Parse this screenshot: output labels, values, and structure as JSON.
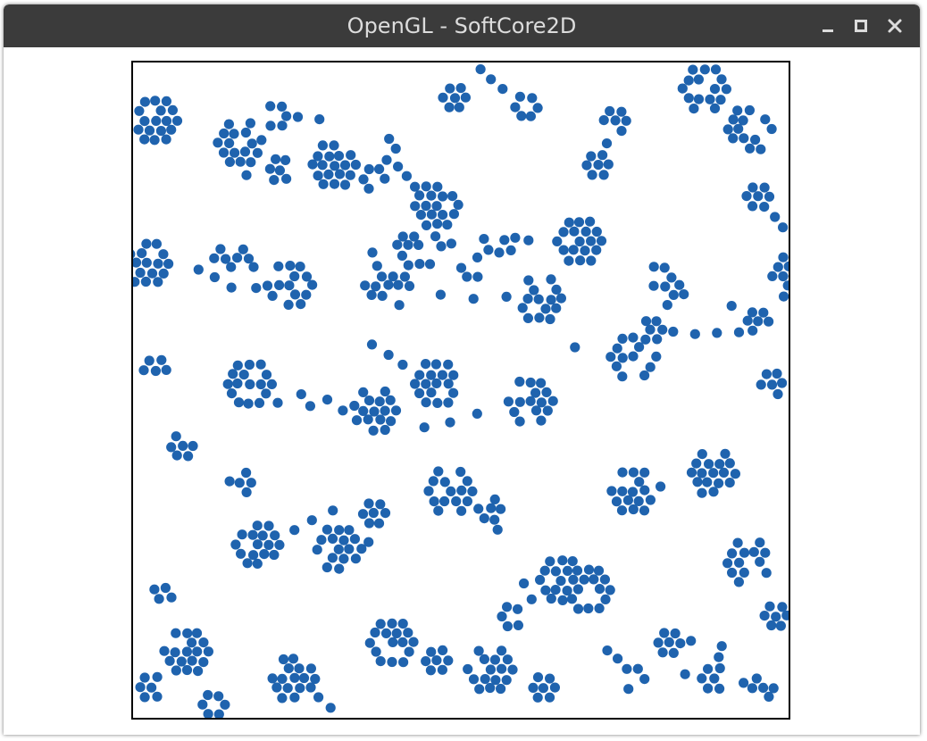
{
  "window": {
    "title": "OpenGL - SoftCore2D",
    "controls": {
      "minimize": "minimize-icon",
      "maximize": "maximize-icon",
      "close": "close-icon"
    }
  },
  "simulation": {
    "particle_color": "#1f63ae",
    "border_color": "#000000",
    "background_color": "#ffffff"
  }
}
